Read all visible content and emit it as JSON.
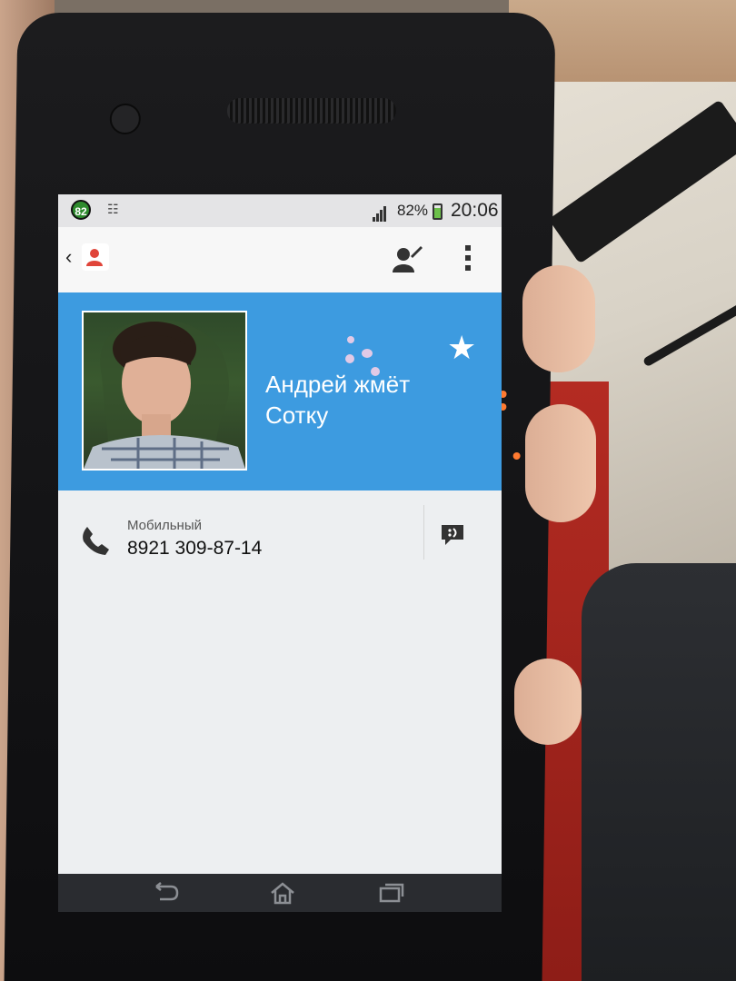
{
  "status_bar": {
    "notification_badge": "82",
    "battery_percent": "82%",
    "time": "20:06",
    "signal_icon": "signal-bars-icon",
    "battery_icon": "battery-icon",
    "battery_level": 0.82
  },
  "action_bar": {
    "back_icon": "chevron-left-icon",
    "app_icon": "contacts-app-icon",
    "edit_icon": "edit-contact-icon",
    "menu_icon": "overflow-menu-icon"
  },
  "contact": {
    "name_line1": "Андрей жмёт",
    "name_line2": "Сотку",
    "favorite_icon": "star-icon",
    "photo": "contact-photo"
  },
  "phone_entry": {
    "label": "Мобильный",
    "number": "8921 309-87-14",
    "call_icon": "phone-handset-icon",
    "sms_icon": "message-bubble-icon"
  },
  "nav_bar": {
    "back_icon": "back-icon",
    "home_icon": "home-icon",
    "recents_icon": "recents-icon"
  },
  "colors": {
    "header_blue": "#3d9be0",
    "screen_bg": "#edeff1",
    "navbar_bg": "#2a2c30"
  }
}
